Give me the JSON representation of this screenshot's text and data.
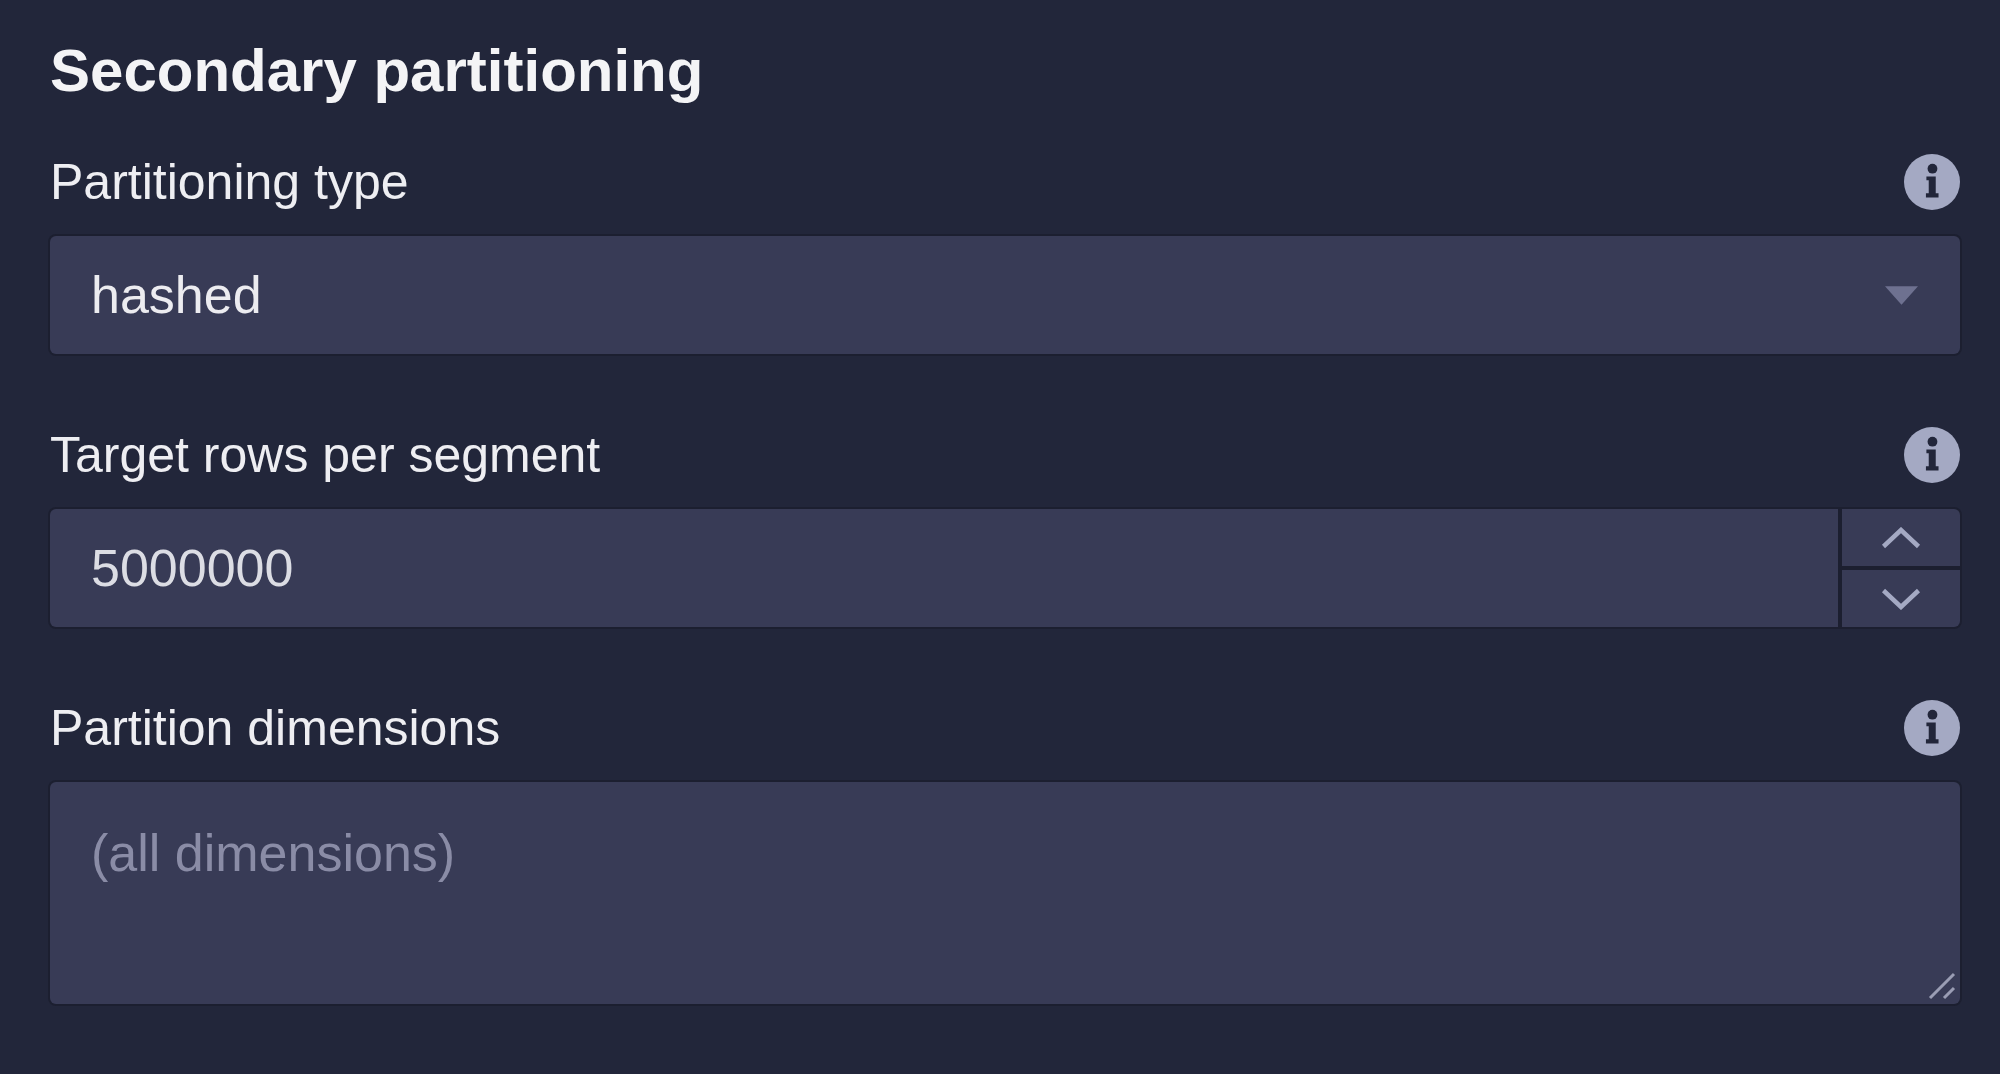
{
  "section": {
    "title": "Secondary partitioning"
  },
  "fields": [
    {
      "kind": "select",
      "label": "Partitioning type",
      "value": "hashed"
    },
    {
      "kind": "number",
      "label": "Target rows per segment",
      "value": "5000000"
    },
    {
      "kind": "textarea",
      "label": "Partition dimensions",
      "placeholder": "(all dimensions)"
    }
  ]
}
